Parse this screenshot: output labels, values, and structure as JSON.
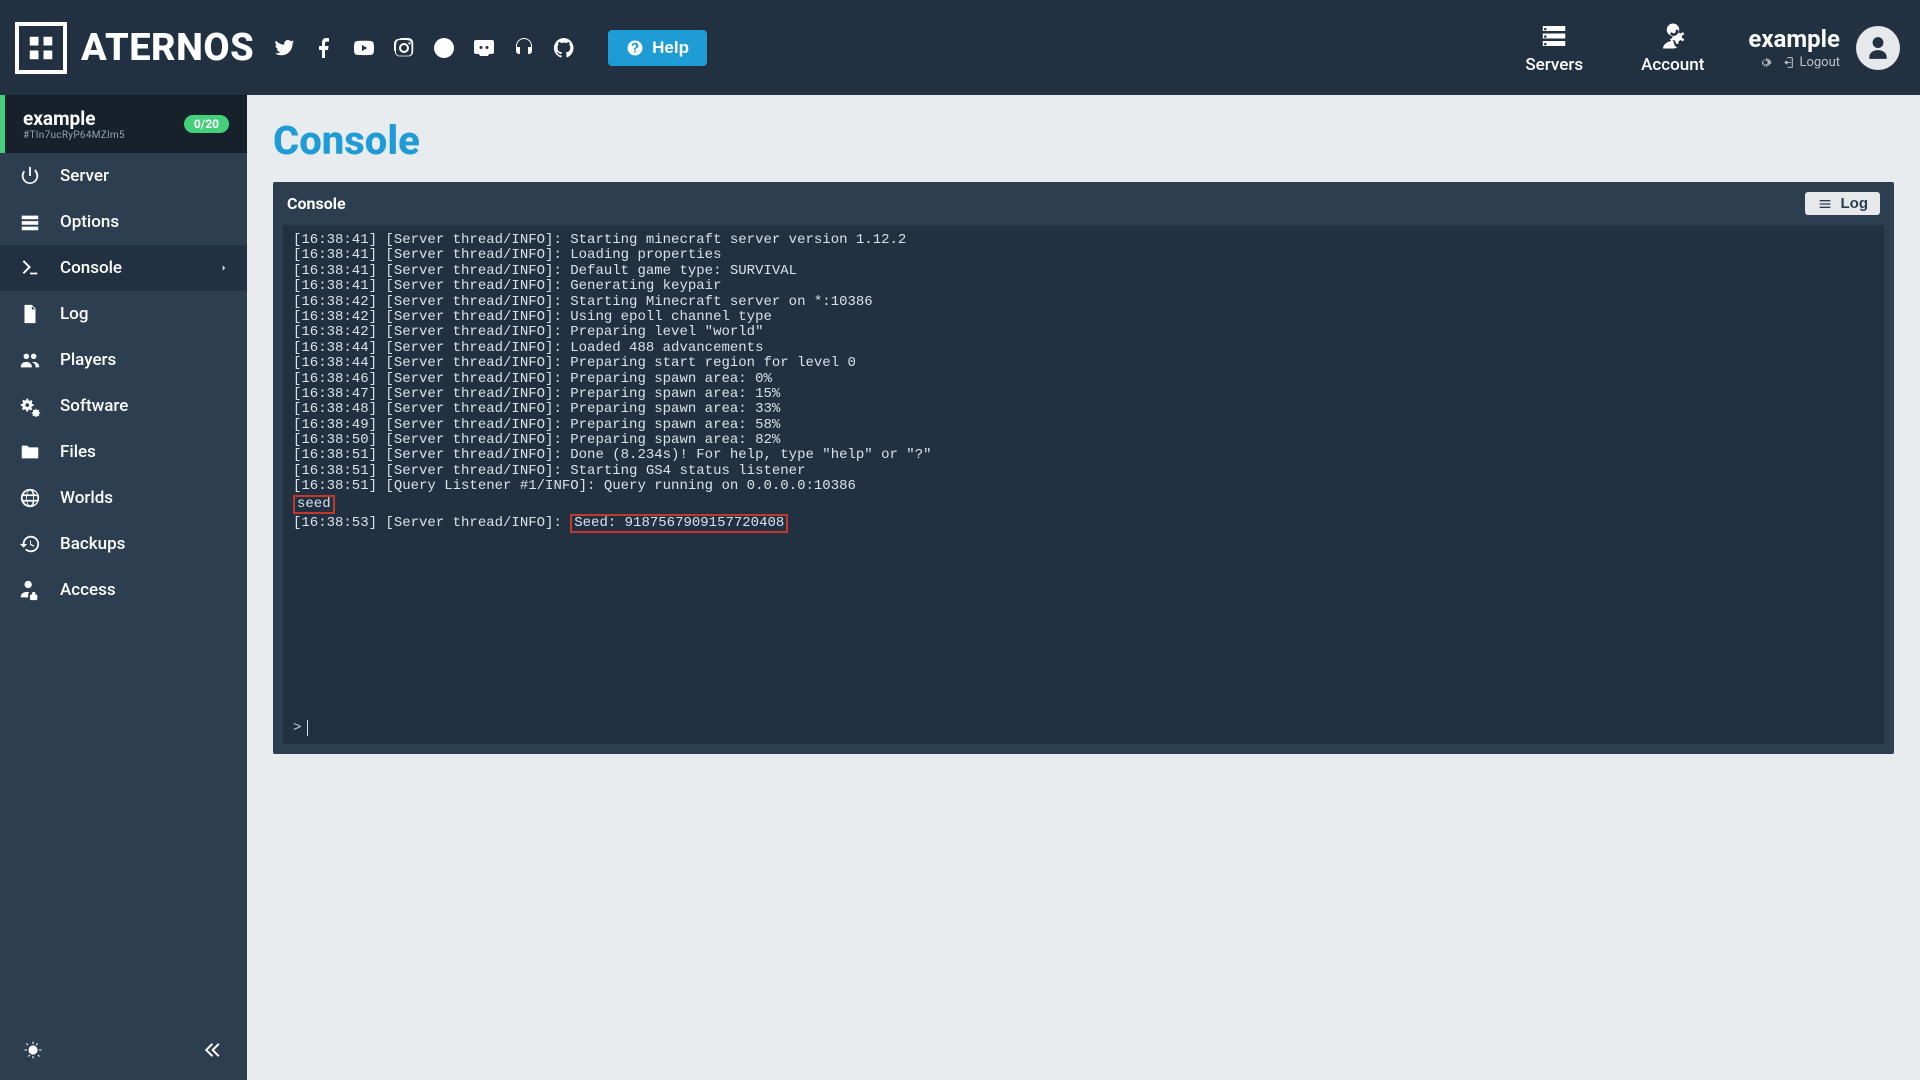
{
  "header": {
    "brand": "ATERNOS",
    "help_label": "Help",
    "nav": {
      "servers": "Servers",
      "account": "Account"
    },
    "user": {
      "name": "example",
      "logout": "Logout"
    }
  },
  "sidebar": {
    "server_name": "example",
    "server_id": "#TIn7ucRyP64MZlm5",
    "badge": "0/20",
    "items": [
      {
        "label": "Server"
      },
      {
        "label": "Options"
      },
      {
        "label": "Console"
      },
      {
        "label": "Log"
      },
      {
        "label": "Players"
      },
      {
        "label": "Software"
      },
      {
        "label": "Files"
      },
      {
        "label": "Worlds"
      },
      {
        "label": "Backups"
      },
      {
        "label": "Access"
      }
    ]
  },
  "page": {
    "title": "Console",
    "panel_title": "Console",
    "log_button": "Log"
  },
  "console": {
    "lines": [
      "[16:38:41] [Server thread/INFO]: Starting minecraft server version 1.12.2",
      "[16:38:41] [Server thread/INFO]: Loading properties",
      "[16:38:41] [Server thread/INFO]: Default game type: SURVIVAL",
      "[16:38:41] [Server thread/INFO]: Generating keypair",
      "[16:38:42] [Server thread/INFO]: Starting Minecraft server on *:10386",
      "[16:38:42] [Server thread/INFO]: Using epoll channel type",
      "[16:38:42] [Server thread/INFO]: Preparing level \"world\"",
      "[16:38:44] [Server thread/INFO]: Loaded 488 advancements",
      "[16:38:44] [Server thread/INFO]: Preparing start region for level 0",
      "[16:38:46] [Server thread/INFO]: Preparing spawn area: 0%",
      "[16:38:47] [Server thread/INFO]: Preparing spawn area: 15%",
      "[16:38:48] [Server thread/INFO]: Preparing spawn area: 33%",
      "[16:38:49] [Server thread/INFO]: Preparing spawn area: 58%",
      "[16:38:50] [Server thread/INFO]: Preparing spawn area: 82%",
      "[16:38:51] [Server thread/INFO]: Done (8.234s)! For help, type \"help\" or \"?\"",
      "[16:38:51] [Server thread/INFO]: Starting GS4 status listener",
      "[16:38:51] [Query Listener #1/INFO]: Query running on 0.0.0.0:10386"
    ],
    "highlight_cmd": "seed",
    "seed_line_prefix": "[16:38:53] [Server thread/INFO]: ",
    "seed_highlight": "Seed: 9187567909157720408",
    "prompt": ">"
  }
}
